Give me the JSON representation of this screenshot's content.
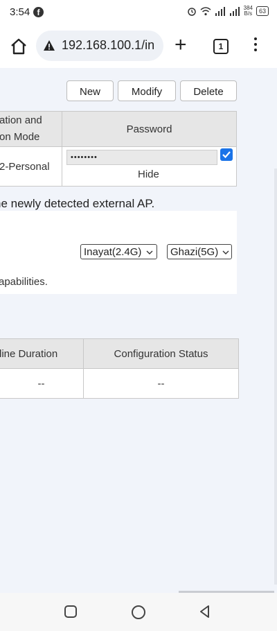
{
  "status": {
    "time": "3:54",
    "fb": "f",
    "net_speed_top": "384",
    "net_speed_unit": "B/s",
    "battery": "63"
  },
  "browser": {
    "url": "192.168.100.1/in",
    "tab_count": "1"
  },
  "buttons": {
    "new": "New",
    "modify": "Modify",
    "delete": "Delete"
  },
  "table1": {
    "header_auth_line1": "ation and",
    "header_auth_line2": "on Mode",
    "header_password": "Password",
    "row_mode": "2-Personal",
    "password_value": "••••••••",
    "show_password_checked": true,
    "hide_label": "Hide"
  },
  "notes": {
    "detected": "he newly detected external AP.",
    "capabilities": "apabilities."
  },
  "selects": {
    "band24": "Inayat(2.4G)",
    "band5": "Ghazi(5G)"
  },
  "table2": {
    "col_online": "line Duration",
    "col_config": "Configuration Status",
    "cell_online": "--",
    "cell_config": "--"
  },
  "icons": {
    "home": "home-icon",
    "warning": "warning-icon",
    "plus": "plus-icon",
    "menu": "more-vert-icon"
  }
}
